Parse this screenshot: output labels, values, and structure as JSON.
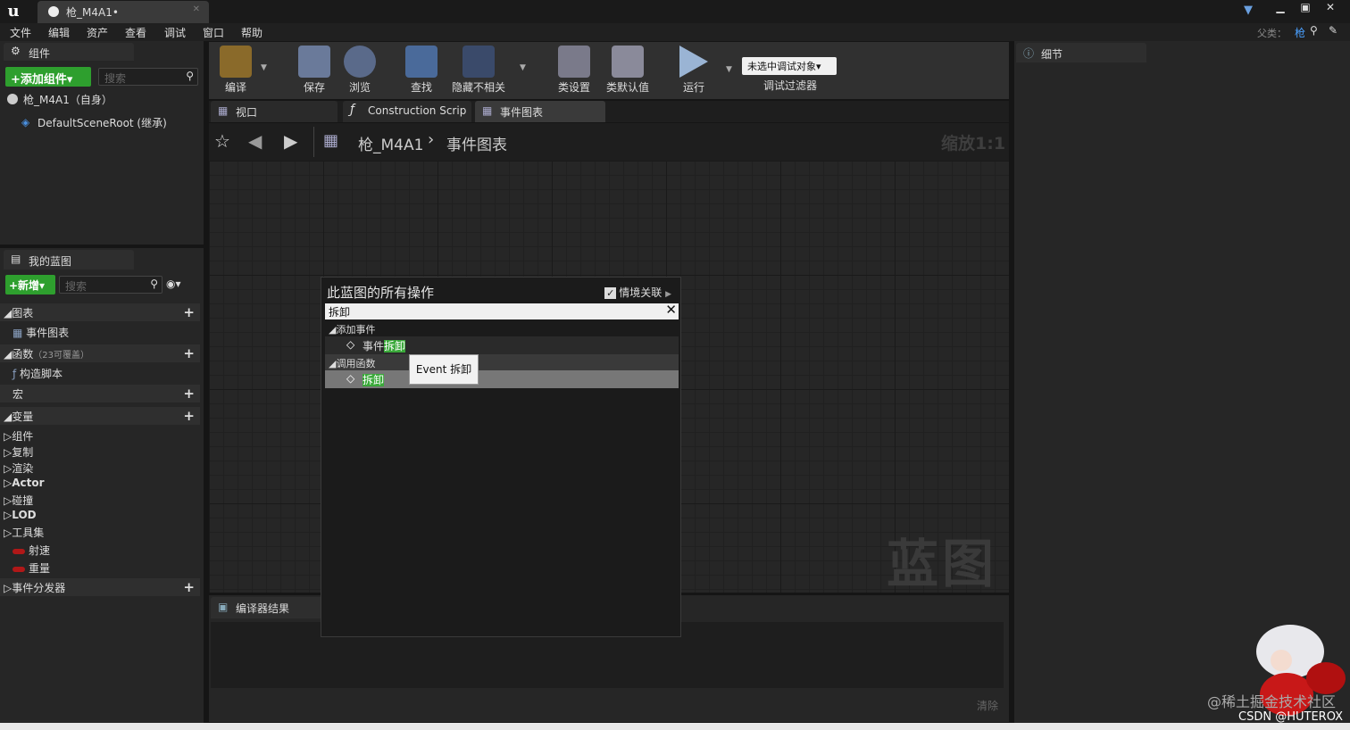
{
  "window": {
    "doc_tab": "枪_M4A1•",
    "logo": "u",
    "buttons": [
      "▁",
      "▣",
      "✕"
    ]
  },
  "menu": {
    "items": [
      "文件",
      "编辑",
      "资产",
      "查看",
      "调试",
      "窗口",
      "帮助"
    ],
    "parent_label": "父类：",
    "parent_value": "枪"
  },
  "components": {
    "tab": "组件",
    "add_button": "+添加组件▾",
    "search_placeholder": "搜索",
    "tree": [
      "枪_M4A1（自身）",
      "DefaultSceneRoot (继承)"
    ]
  },
  "mybp": {
    "tab": "我的蓝图",
    "new_button": "+新增▾",
    "search_placeholder": "搜索",
    "graphs_header": "◢图表",
    "graph_item": "事件图表",
    "functions_header": "◢函数",
    "functions_note": "（23可覆盖）",
    "function_item": "构造脚本",
    "macros_header": "宏",
    "variables_header": "◢变量",
    "var_groups": [
      "▷组件",
      "▷复制",
      "▷渲染",
      "▷Actor",
      "▷碰撞",
      "▷LOD",
      "▷工具集"
    ],
    "vars": [
      "射速",
      "重量"
    ],
    "dispatchers_header": "▷事件分发器"
  },
  "toolbar": {
    "items": [
      "编译",
      "保存",
      "浏览",
      "查找",
      "隐藏不相关",
      "类设置",
      "类默认值",
      "运行"
    ],
    "debug_select": "未选中调试对象▾",
    "debug_filter": "调试过滤器"
  },
  "editor_tabs": [
    "视口",
    "Construction Scrip",
    "事件图表"
  ],
  "graph": {
    "breadcrumb_root": "枪_M4A1",
    "breadcrumb_sep": "›",
    "breadcrumb_leaf": "事件图表",
    "zoom": "缩放1:1",
    "watermark": "蓝图"
  },
  "popup": {
    "title": "此蓝图的所有操作",
    "context_label": "情境关联",
    "search_value": "拆卸",
    "cat_add_event": "◢添加事件",
    "item_event_prefix": "事件",
    "item_event_hl": "拆卸",
    "cat_call_func": "◢调用函数",
    "item_func_hl": "拆卸",
    "tooltip": "Event 拆卸"
  },
  "compiler": {
    "tab": "编译器结果",
    "clear": "清除"
  },
  "details": {
    "tab": "细节"
  },
  "watermarks": {
    "juejin": "@稀土掘金技术社区",
    "csdn": "CSDN @HUTEROX"
  }
}
